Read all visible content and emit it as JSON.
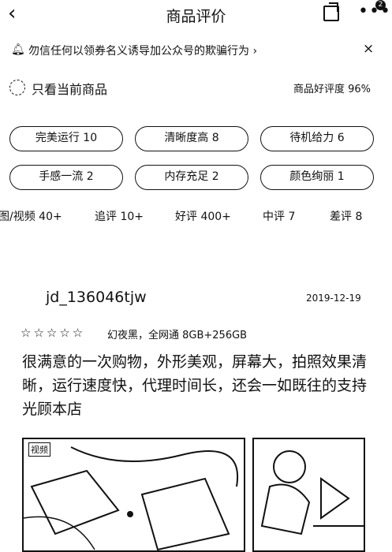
{
  "header": {
    "back_icon": "chevron-left-icon",
    "title": "商品评价",
    "share_icon": "share-icon",
    "more_icon": "more-icon",
    "badge": "2"
  },
  "notice": {
    "icon": "bell-icon",
    "text": "勿信任何以领券名义诱导加公众号的欺骗行为 ›",
    "close": "×"
  },
  "filter": {
    "label": "只看当前商品",
    "rating": "商品好评度 96%"
  },
  "tags": [
    "完美运行 10",
    "清晰度高 8",
    "待机给力 6",
    "手感一流 2",
    "内存充足 2",
    "颜色绚丽 1"
  ],
  "tabs": [
    "图/视频 40+",
    "追评 10+",
    "好评 400+",
    "中评 7",
    "差评 8"
  ],
  "review": {
    "user": "jd_136046tjw",
    "date": "2019-12-19",
    "stars": 5,
    "variant": "幻夜黑，全网通 8GB+256GB",
    "text": "很满意的一次购物，外形美观，屏幕大，拍照效果清晰，运行速度快，代理时间长，还会一如既往的支持光顾本店",
    "photo_tag": "视频"
  },
  "colors": {
    "text": "#111111",
    "background": "#ffffff"
  }
}
